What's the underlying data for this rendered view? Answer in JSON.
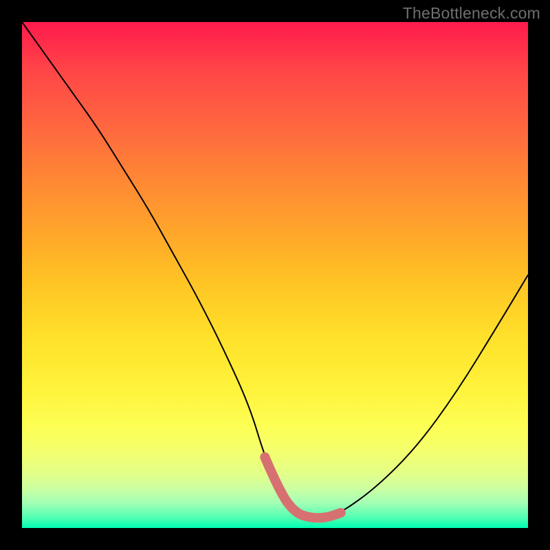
{
  "watermark": "TheBottleneck.com",
  "colors": {
    "accent": "#d77171",
    "curve": "#000000",
    "frame": "#000000"
  },
  "chart_data": {
    "type": "line",
    "title": "",
    "xlabel": "",
    "ylabel": "",
    "xlim": [
      0,
      100
    ],
    "ylim": [
      0,
      100
    ],
    "grid": false,
    "legend": false,
    "series": [
      {
        "name": "bottleneck-curve",
        "x": [
          0,
          5,
          10,
          15,
          20,
          25,
          30,
          35,
          40,
          45,
          48,
          51,
          54,
          57,
          60,
          63,
          70,
          78,
          86,
          94,
          100
        ],
        "values": [
          100,
          93,
          86,
          79,
          71,
          63,
          54,
          45,
          35,
          24,
          14,
          7,
          3,
          2,
          2,
          3,
          8,
          16,
          27,
          40,
          50
        ]
      }
    ],
    "accent_segment": {
      "x": [
        48,
        51,
        54,
        57,
        60,
        63
      ],
      "values": [
        14,
        7,
        3,
        2,
        2,
        3
      ]
    },
    "annotations": []
  }
}
